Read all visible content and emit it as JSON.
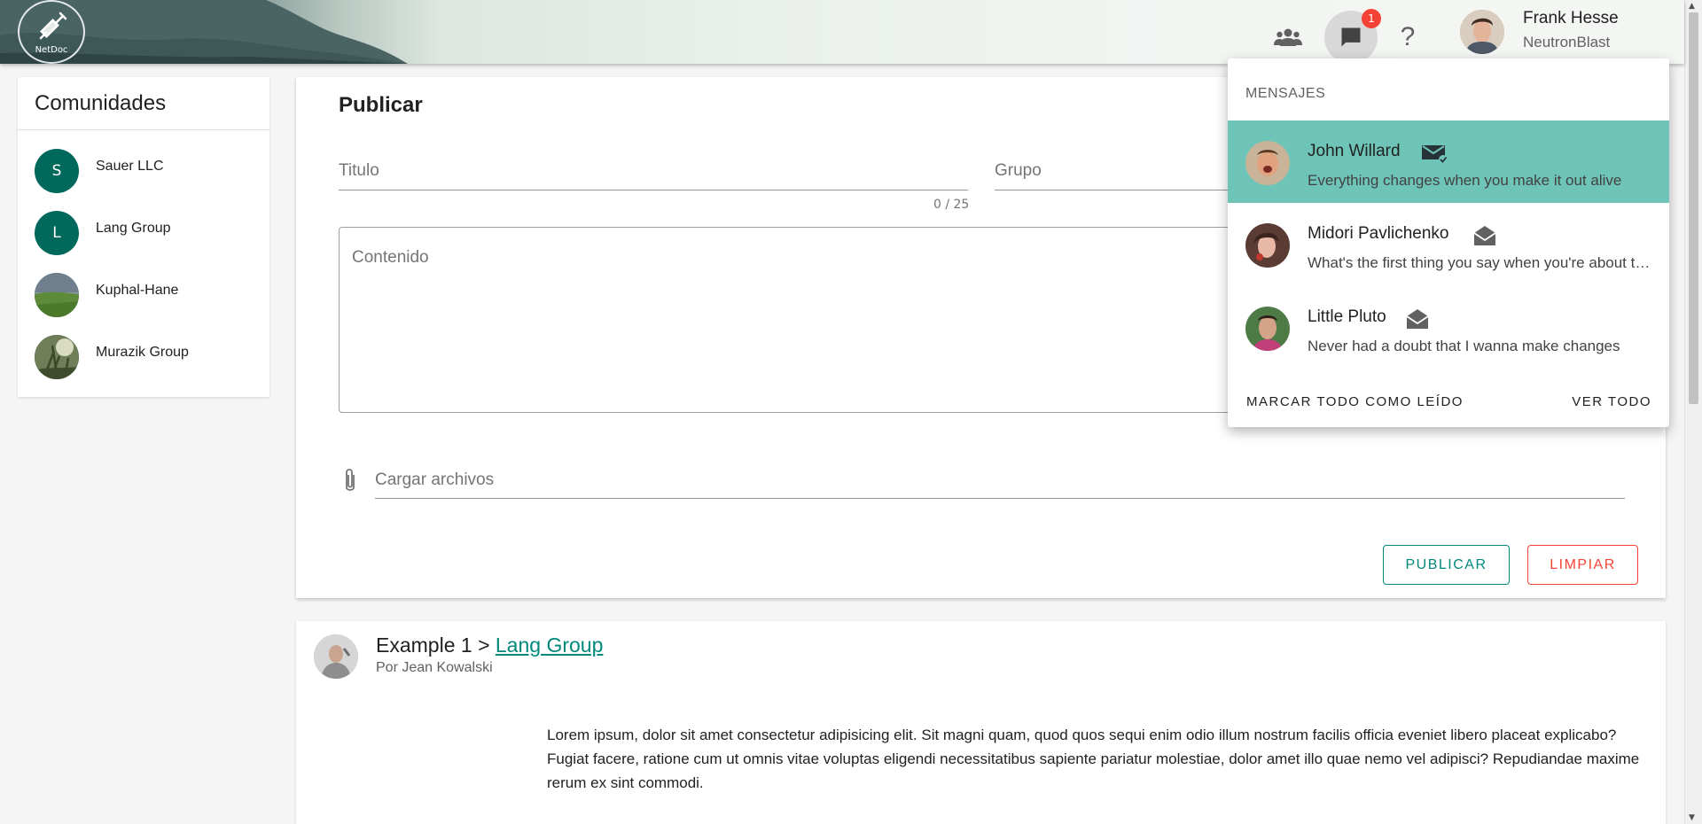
{
  "header": {
    "logo_text": "NetDoc",
    "notification_count": "1",
    "help_label": "?",
    "user_name": "Frank Hesse",
    "user_handle": "NeutronBlast",
    "icons": [
      "people-icon",
      "chat-icon",
      "help-icon"
    ]
  },
  "communities": {
    "title": "Comunidades",
    "items": [
      {
        "label": "Sauer LLC",
        "initial": "S"
      },
      {
        "label": "Lang Group",
        "initial": "L"
      },
      {
        "label": "Kuphal-Hane",
        "initial": ""
      },
      {
        "label": "Murazik Group",
        "initial": ""
      }
    ]
  },
  "publish": {
    "title": "Publicar",
    "title_placeholder": "Titulo",
    "group_placeholder": "Grupo",
    "counter": "0 / 25",
    "content_placeholder": "Contenido",
    "upload_placeholder": "Cargar archivos",
    "publish_button": "PUBLICAR",
    "clear_button": "LIMPIAR"
  },
  "post": {
    "title": "Example 1",
    "separator": ">",
    "group_link": "Lang Group",
    "author": "Por Jean Kowalski",
    "body": "Lorem ipsum, dolor sit amet consectetur adipisicing elit. Sit magni quam, quod quos sequi enim odio illum nostrum facilis officia eveniet libero placeat explicabo? Fugiat facere, ratione cum ut omnis vitae voluptas eligendi necessitatibus sapiente pariatur molestiae, dolor amet illo quae nemo vel adipisci? Repudiandae maxime rerum ex sint commodi."
  },
  "messages_menu": {
    "title": "MENSAJES",
    "items": [
      {
        "name": "John Willard",
        "preview": "Everything changes when you make it out alive",
        "status": "unread",
        "selected": true
      },
      {
        "name": "Midori Pavlichenko",
        "preview": "What's the first thing you say when you're about to...",
        "status": "read",
        "selected": false
      },
      {
        "name": "Little Pluto",
        "preview": "Never had a doubt that I wanna make changes",
        "status": "read",
        "selected": false
      }
    ],
    "mark_all_read": "MARCAR TODO COMO LEÍDO",
    "see_all": "VER TODO"
  },
  "colors": {
    "accent": "#00897b",
    "selected_row": "#6ec4b6",
    "danger": "#f44336",
    "community_avatar": "#00695c"
  }
}
